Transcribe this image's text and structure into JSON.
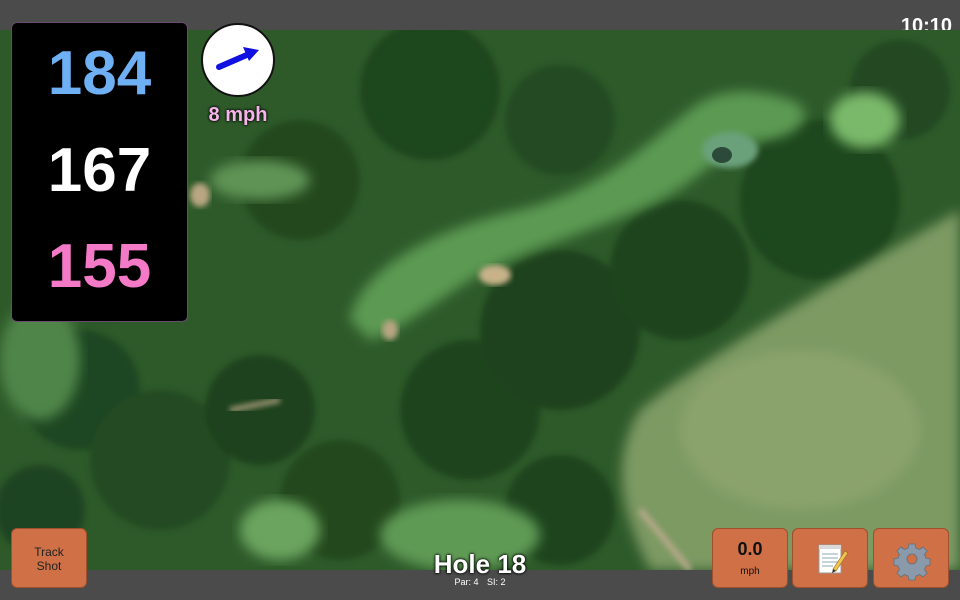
{
  "status_bar": {
    "time": "10:10"
  },
  "distances": {
    "back": "184",
    "center": "167",
    "front": "155"
  },
  "distance_colors": {
    "back": "#6fb0f5",
    "center": "#ffffff",
    "front": "#f47ac8"
  },
  "wind": {
    "speed_label": "8 mph",
    "direction_icon": "arrow-right-icon",
    "arrow_color": "#1010e0"
  },
  "track_shot": {
    "line1": "Track",
    "line2": "Shot"
  },
  "speed": {
    "value": "0.0",
    "unit": "mph"
  },
  "notes": {
    "icon": "notepad-icon"
  },
  "settings": {
    "icon": "gear-icon"
  },
  "hole": {
    "title": "Hole 18",
    "par_label": "Par: 4",
    "si_label": "SI: 2"
  },
  "colors": {
    "button": "#cf7046",
    "bar": "#4b4b4b"
  }
}
